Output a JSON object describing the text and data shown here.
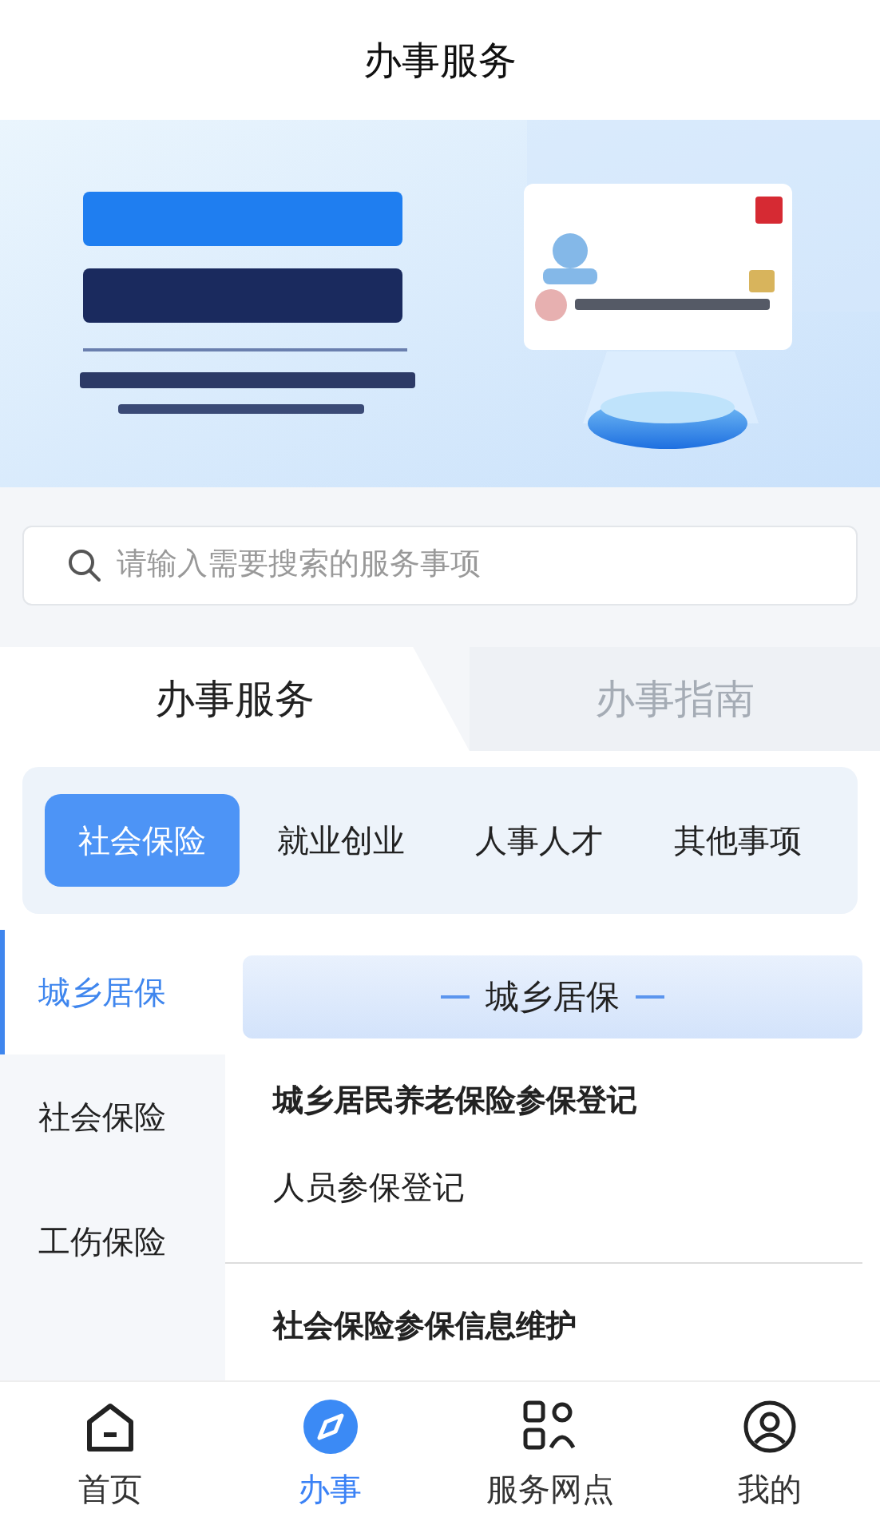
{
  "header": {
    "title": "办事服务"
  },
  "search": {
    "placeholder": "请输入需要搜索的服务事项"
  },
  "tabs": [
    {
      "label": "办事服务",
      "selected": true
    },
    {
      "label": "办事指南",
      "selected": false
    }
  ],
  "categories": [
    {
      "label": "社会保险",
      "selected": true
    },
    {
      "label": "就业创业",
      "selected": false
    },
    {
      "label": "人事人才",
      "selected": false
    },
    {
      "label": "其他事项",
      "selected": false
    }
  ],
  "sidebar": {
    "items": [
      {
        "label": "城乡居保",
        "selected": true
      },
      {
        "label": "社会保险",
        "selected": false
      },
      {
        "label": "工伤保险",
        "selected": false
      }
    ]
  },
  "content": {
    "heading": "城乡居保",
    "groups": [
      {
        "title": "城乡居民养老保险参保登记",
        "items": [
          "人员参保登记"
        ]
      },
      {
        "title": "社会保险参保信息维护"
      }
    ]
  },
  "bottom_nav": [
    {
      "label": "首页",
      "selected": false
    },
    {
      "label": "办事",
      "selected": true
    },
    {
      "label": "服务网点",
      "selected": false
    },
    {
      "label": "我的",
      "selected": false
    }
  ]
}
